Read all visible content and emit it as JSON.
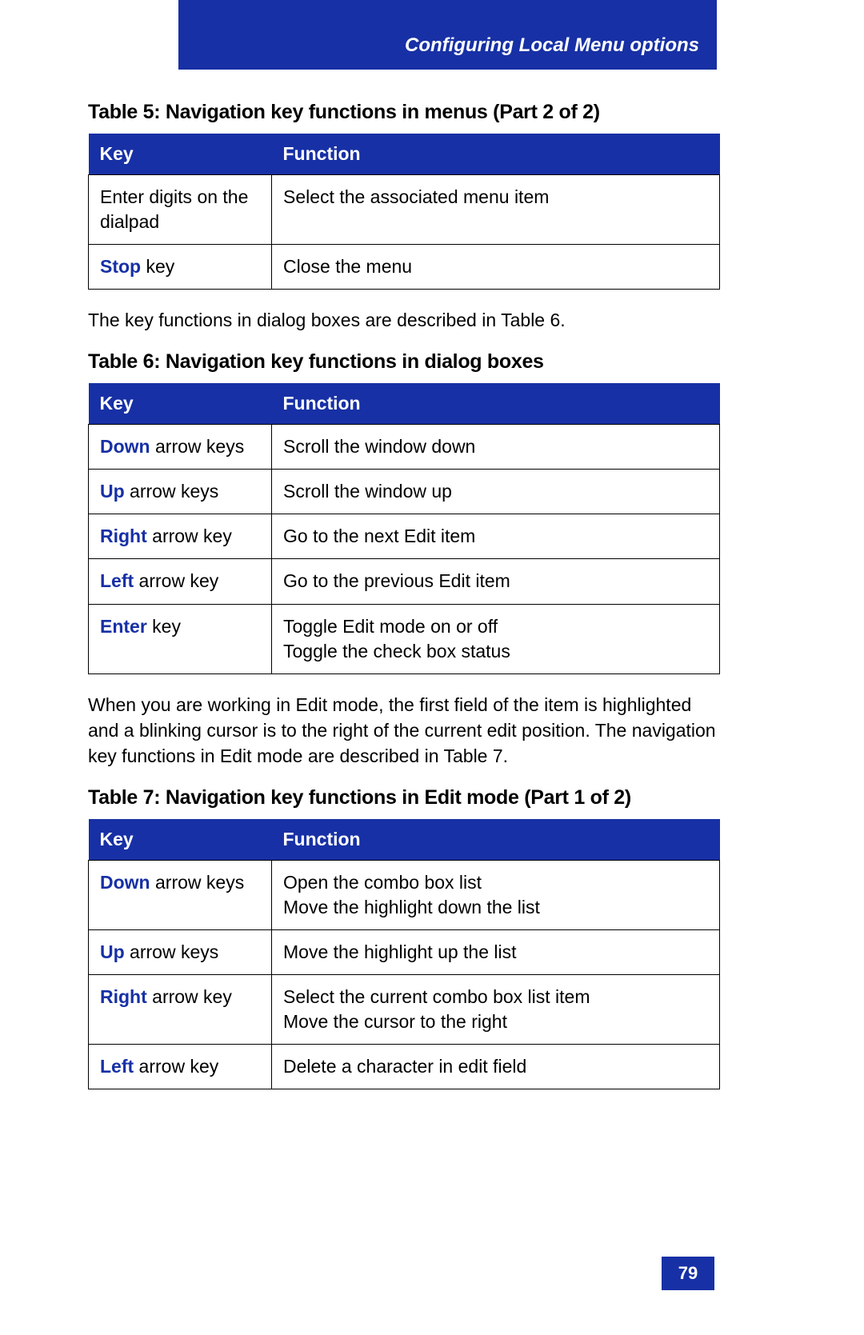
{
  "header": {
    "section_title": "Configuring Local Menu options"
  },
  "table5": {
    "caption": "Table 5: Navigation key functions in menus (Part 2 of 2)",
    "head": {
      "key": "Key",
      "func": "Function"
    },
    "rows": [
      {
        "key_bold": "",
        "key_rest": "Enter digits on the dialpad",
        "func": "Select the associated menu item"
      },
      {
        "key_bold": "Stop",
        "key_rest": " key",
        "func": "Close the menu"
      }
    ]
  },
  "para1": "The key functions in dialog boxes are described in Table 6.",
  "table6": {
    "caption": "Table 6: Navigation key functions in dialog boxes",
    "head": {
      "key": "Key",
      "func": "Function"
    },
    "rows": [
      {
        "key_bold": "Down",
        "key_rest": " arrow keys",
        "func": "Scroll the window down"
      },
      {
        "key_bold": "Up",
        "key_rest": " arrow keys",
        "func": "Scroll the window up"
      },
      {
        "key_bold": "Right",
        "key_rest": " arrow key",
        "func": "Go to the next Edit item"
      },
      {
        "key_bold": "Left",
        "key_rest": " arrow key",
        "func": "Go to the previous Edit item"
      },
      {
        "key_bold": "Enter",
        "key_rest": " key",
        "func": "Toggle Edit mode on or off\nToggle the check box status"
      }
    ]
  },
  "para2": "When you are working in Edit mode, the first field of the item is highlighted and a blinking cursor is to the right of the current edit position. The navigation key functions in Edit mode are described in Table 7.",
  "table7": {
    "caption": "Table 7: Navigation key functions in Edit mode (Part 1 of 2)",
    "head": {
      "key": "Key",
      "func": "Function"
    },
    "rows": [
      {
        "key_bold": "Down",
        "key_rest": " arrow keys",
        "func": "Open the combo box list\nMove the highlight down the list"
      },
      {
        "key_bold": "Up",
        "key_rest": " arrow keys",
        "func": "Move the highlight up the list"
      },
      {
        "key_bold": "Right",
        "key_rest": " arrow key",
        "func": "Select the current combo box list item\nMove the cursor to the right"
      },
      {
        "key_bold": "Left",
        "key_rest": " arrow key",
        "func": "Delete a character in edit field"
      }
    ]
  },
  "page_number": "79"
}
